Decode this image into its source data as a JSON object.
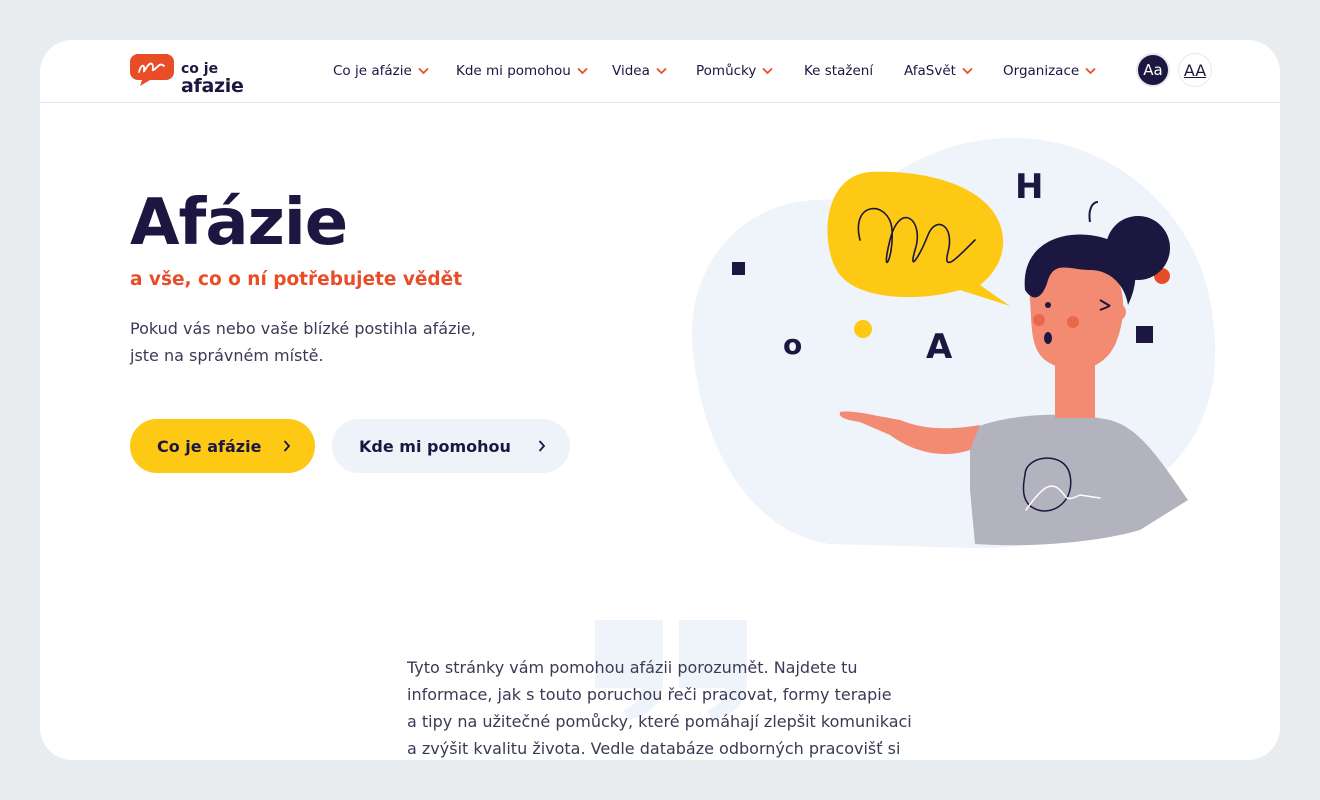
{
  "logo": {
    "line1": "co je",
    "line2": "afazie",
    "brand_color": "#e84d28",
    "icon": "speech-bubble-icon"
  },
  "nav": {
    "items": [
      {
        "label": "Co je afázie",
        "has_dropdown": true
      },
      {
        "label": "Kde mi pomohou",
        "has_dropdown": true
      },
      {
        "label": "Videa",
        "has_dropdown": true
      },
      {
        "label": "Pomůcky",
        "has_dropdown": true
      },
      {
        "label": "Ke stažení",
        "has_dropdown": false
      },
      {
        "label": "AfaSvět",
        "has_dropdown": true
      },
      {
        "label": "Organizace",
        "has_dropdown": true
      }
    ],
    "font_small": "Aa",
    "font_large": "AA"
  },
  "hero": {
    "title": "Afázie",
    "subtitle": "a vše, co o ní potřebujete vědět",
    "text_line1": "Pokud vás nebo vaše blízké postihla afázie,",
    "text_line2": "jste na správném místě.",
    "primary_button": "Co je afázie",
    "secondary_button": "Kde mi pomohou"
  },
  "illustration": {
    "letter_h": "H",
    "letter_o": "o",
    "letter_a": "A"
  },
  "intro": {
    "line1": "Tyto stránky vám pomohou afázii porozumět. Najdete tu",
    "line2": "informace, jak s touto poruchou řeči pracovat, formy terapie",
    "line3": "a tipy na užitečné pomůcky, které pomáhají zlepšit komunikaci",
    "line4": "a zvýšit kvalitu života. Vedle databáze odborných pracovišť si"
  },
  "colors": {
    "accent_orange": "#e84d28",
    "accent_yellow": "#fdc914",
    "navy": "#1b1740",
    "light_blue": "#eef3f9"
  }
}
